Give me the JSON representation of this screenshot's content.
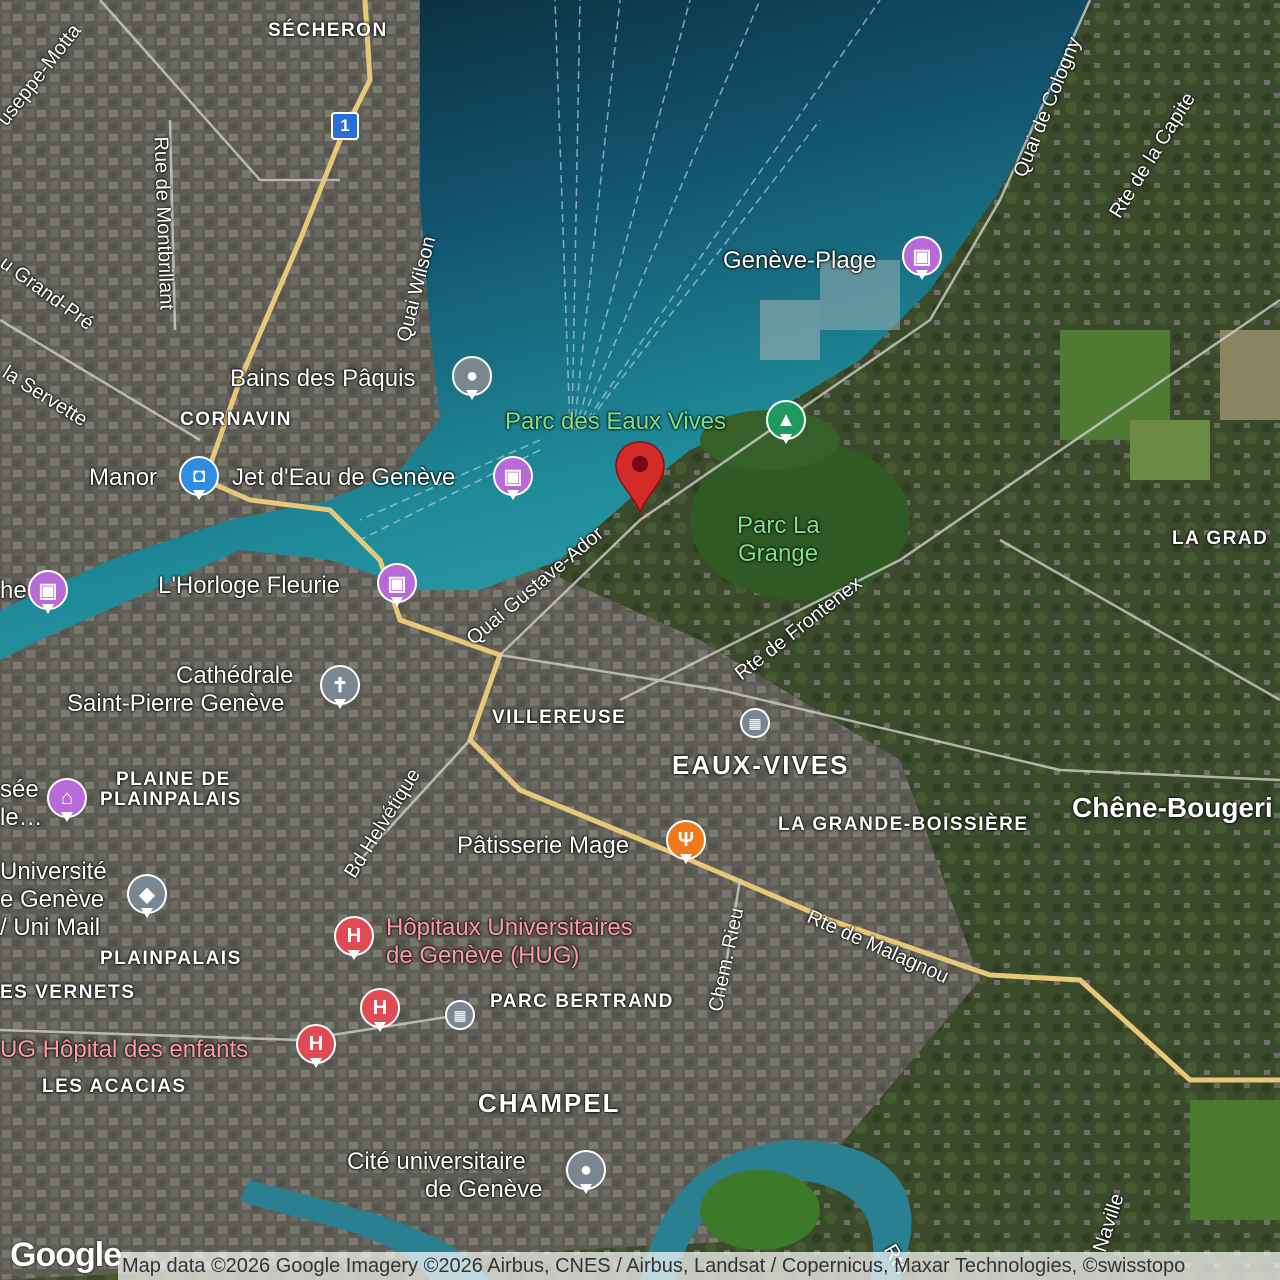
{
  "pois": [
    {
      "id": "geneve-plage",
      "name": "Genève-Plage",
      "category": "photo-attraction",
      "color": "#b86bd8"
    },
    {
      "id": "bains-des-paquis",
      "name": "Bains des Pâquis",
      "category": "place",
      "color": "#7a8790"
    },
    {
      "id": "parc-des-eaux-vives",
      "name": "Parc des Eaux Vives",
      "category": "park",
      "color": "#1e9a5c"
    },
    {
      "id": "manor",
      "name": "Manor",
      "category": "shopping",
      "color": "#2e8de0"
    },
    {
      "id": "jet-d-eau",
      "name": "Jet d'Eau de Genève",
      "category": "photo-attraction",
      "color": "#b86bd8"
    },
    {
      "id": "l-horloge-fleurie",
      "name": "L'Horloge Fleurie",
      "category": "photo-attraction",
      "color": "#b86bd8"
    },
    {
      "id": "cathedrale",
      "name": "Cathédrale\nSaint-Pierre Genève",
      "line1": "Cathédrale",
      "line2": "Saint-Pierre Genève",
      "category": "church",
      "color": "#7a8790"
    },
    {
      "id": "musee",
      "line1": "sée",
      "line2": "le…",
      "category": "museum",
      "color": "#b86bd8"
    },
    {
      "id": "universite",
      "line1": "Université",
      "line2": "e Genève",
      "line3": "/ Uni Mail",
      "category": "school",
      "color": "#7a8790"
    },
    {
      "id": "hug",
      "line1": "Hôpitaux Universitaires",
      "line2": "de Genève (HUG)",
      "category": "hospital",
      "color": "#e04a55"
    },
    {
      "id": "hug-enfants",
      "name": "UG Hôpital des enfants",
      "category": "hospital",
      "color": "#e04a55"
    },
    {
      "id": "patisserie-mage",
      "name": "Pâtisserie Mage",
      "category": "restaurant",
      "color": "#f07a1a"
    },
    {
      "id": "cite-universitaire",
      "line1": "Cité universitaire",
      "line2": "de Genève",
      "category": "place",
      "color": "#7a8790"
    },
    {
      "id": "left-photo",
      "name": "he",
      "category": "photo-attraction",
      "color": "#b86bd8"
    }
  ],
  "parks": {
    "parc_la_grange_l1": "Parc La",
    "parc_la_grange_l2": "Grange"
  },
  "districts": {
    "secheron": "SÉCHERON",
    "cornavin": "CORNAVIN",
    "villereuse": "VILLEREUSE",
    "eaux_vives": "EAUX-VIVES",
    "plaine_l1": "PLAINE DE",
    "plaine_l2": "PLAINPALAIS",
    "plainpalais": "PLAINPALAIS",
    "les_vernets": "ES VERNETS",
    "les_acacias": "LES ACACIAS",
    "champel": "CHAMPEL",
    "parc_bertrand": "PARC BERTRAND",
    "grande_boissiere": "LA GRANDE-BOISSIÈRE",
    "la_grange": "LA GRAD",
    "chene_bougeries": "Chêne-Bougeri"
  },
  "streets": {
    "quai_wilson": "Quai Wilson",
    "rue_montbrillant": "Rue de Montbrillant",
    "quai_cologny": "Quai de Cologny",
    "rte_capite": "Rte de la Capite",
    "quai_gustave_ador": "Quai Gustave-Ador",
    "rte_frontenex": "Rte de Frontenex",
    "bd_helvetique": "Bd Helvétique",
    "chem_rieu": "Chem. Rieu",
    "rte_malagnou": "Rte de Malagnou",
    "grand_pre": "u Grand-Pré",
    "servette": "la Servette",
    "giuseppe_motta": "useppe-Motta",
    "naville": "Naville",
    "rte_bottom": "Rte"
  },
  "shield": "1",
  "google_logo": "Google",
  "attribution": "Map data ©2026 Google Imagery ©2026 Airbus, CNES / Airbus, Landsat / Copernicus, Maxar Technologies, ©swisstopo",
  "colors": {
    "lake_deep": "#0f2c3c",
    "lake_mid": "#16607a",
    "lake_shallow": "#2a9aa8",
    "land": "#4a5040",
    "urban": "#6b6a63",
    "park": "#3e6a2e",
    "road_major": "#e8c878",
    "pin": "#d42a2a"
  }
}
